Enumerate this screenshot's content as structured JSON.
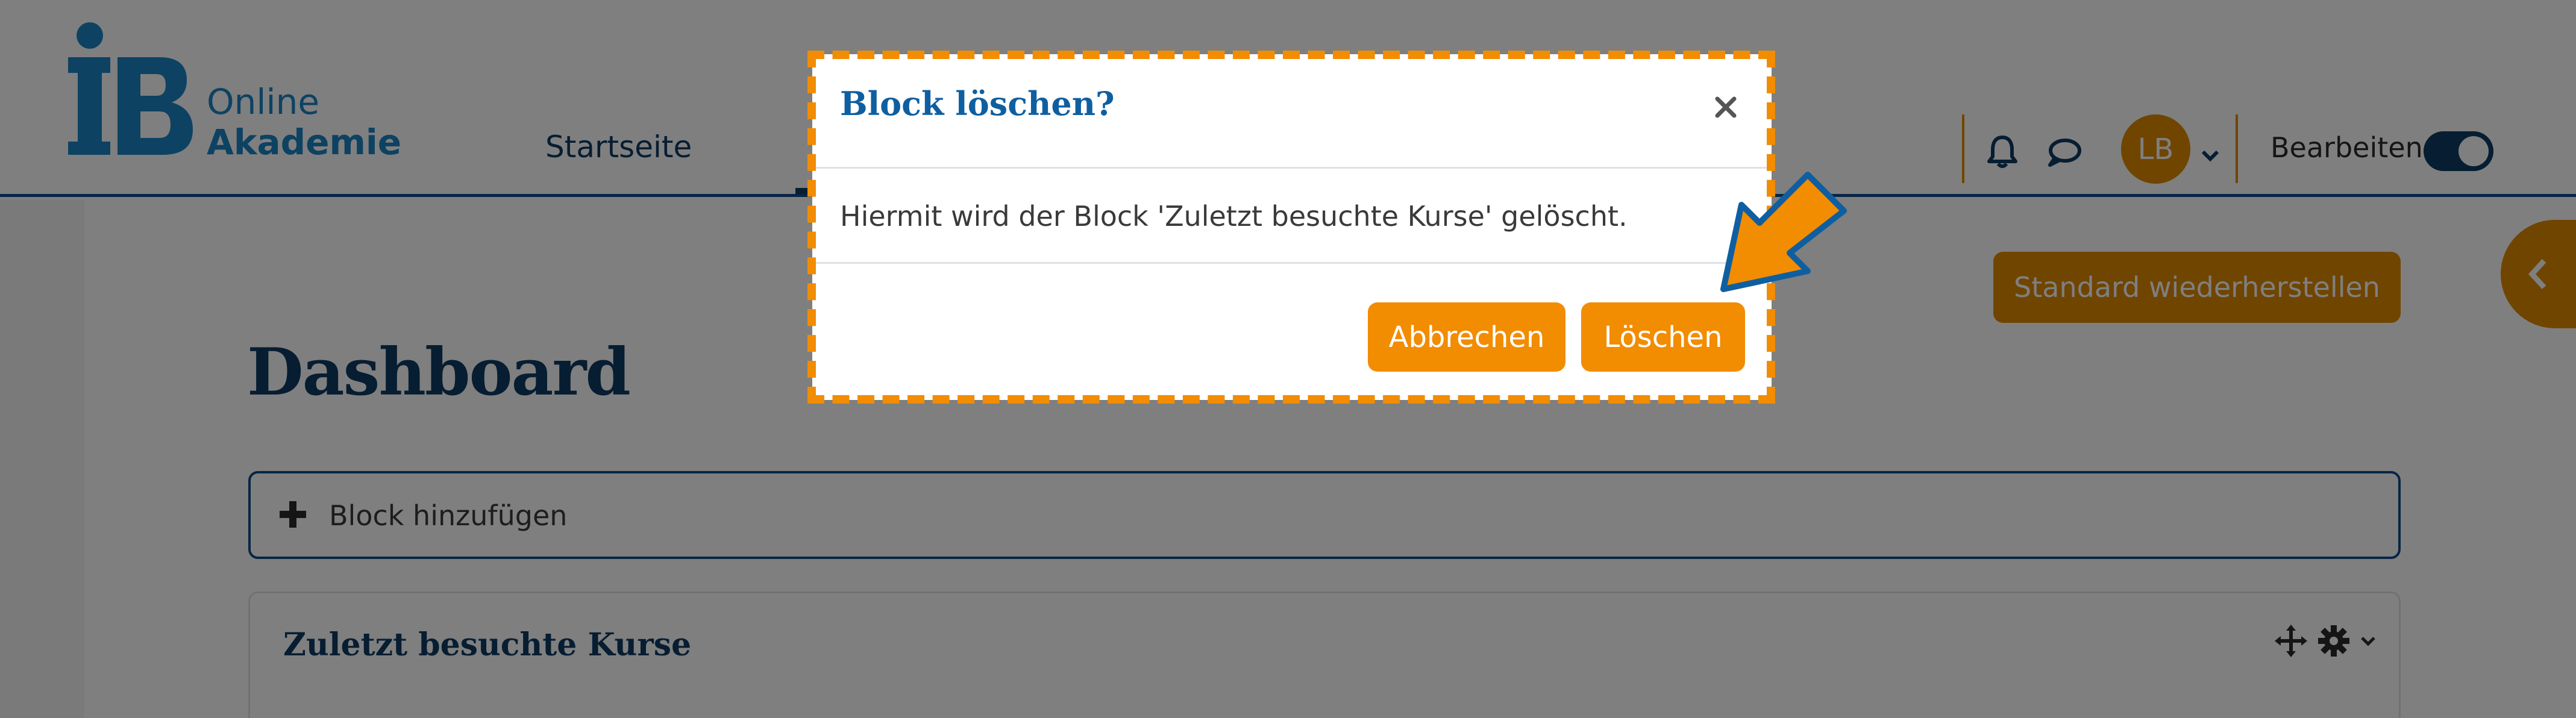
{
  "header": {
    "logo_online": "Online",
    "logo_akademie": "Akademie",
    "nav_home": "Startseite",
    "avatar_initials": "LB",
    "edit_label": "Bearbeiten",
    "edit_mode_on": true
  },
  "main": {
    "restore_button": "Standard wiederherstellen",
    "title": "Dashboard",
    "add_block_label": "Block hinzufügen",
    "block_title": "Zuletzt besuchte Kurse"
  },
  "modal": {
    "title": "Block löschen?",
    "body": "Hiermit wird der Block 'Zuletzt besuchte Kurse' gelöscht.",
    "cancel_label": "Abbrechen",
    "delete_label": "Löschen"
  },
  "colors": {
    "brand_blue": "#0f3b63",
    "logo_blue": "#1b85c4",
    "accent_orange": "#f28c00"
  },
  "icons": {
    "notifications": "bell-icon",
    "messages": "chat-icon",
    "close": "close-icon",
    "move": "move-icon",
    "settings": "gear-icon"
  }
}
